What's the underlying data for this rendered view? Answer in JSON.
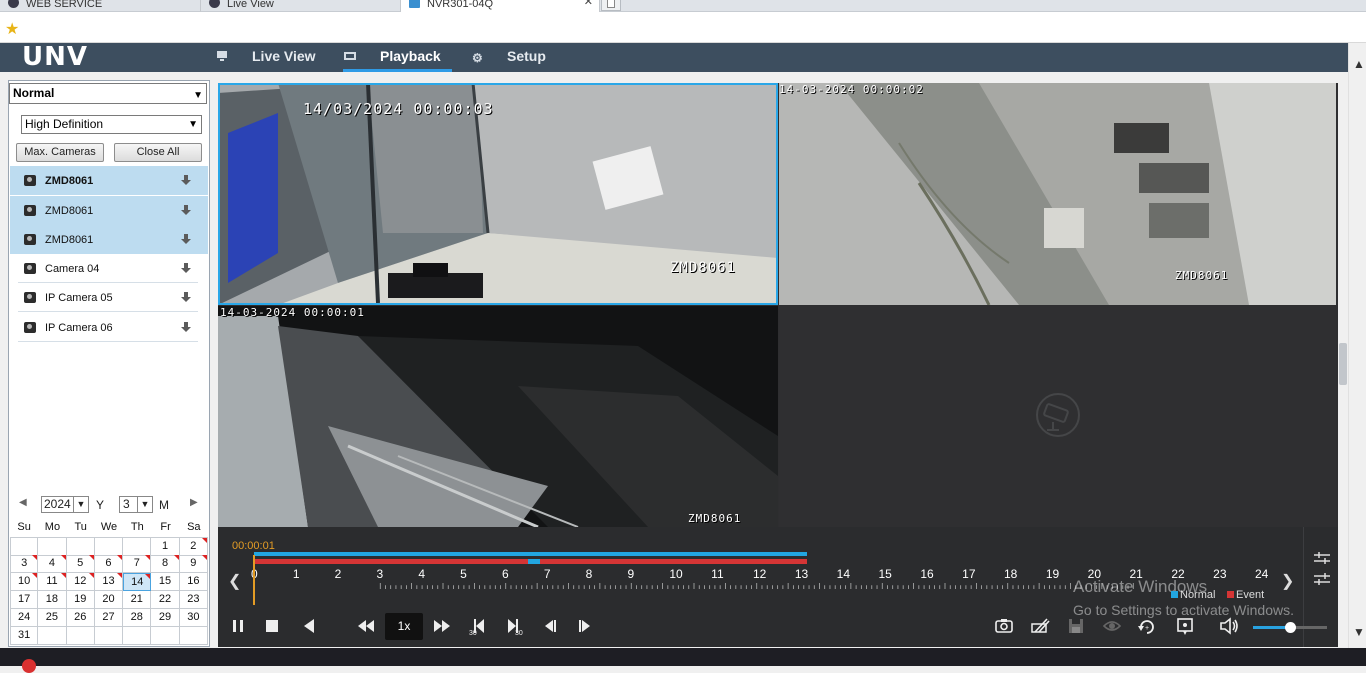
{
  "browser": {
    "tabs": [
      {
        "label": "WEB SERVICE"
      },
      {
        "label": "Live View"
      },
      {
        "label": "NVR301-04Q",
        "active": true
      }
    ]
  },
  "header": {
    "logo": "UNV",
    "nav": [
      {
        "label": "Live View",
        "icon": "monitor-icon"
      },
      {
        "label": "Playback",
        "icon": "film-icon",
        "active": true
      },
      {
        "label": "Setup",
        "icon": "gear-icon"
      }
    ]
  },
  "left": {
    "mode_select": "Normal",
    "quality_select": "High Definition",
    "max_cameras_label": "Max. Cameras",
    "close_all_label": "Close All",
    "cameras": [
      {
        "label": "ZMD8061",
        "selected": true,
        "bold": true
      },
      {
        "label": "ZMD8061",
        "selected": true
      },
      {
        "label": "ZMD8061",
        "selected": true
      },
      {
        "label": "Camera 04"
      },
      {
        "label": "IP Camera 05"
      },
      {
        "label": "IP Camera 06"
      }
    ],
    "calendar": {
      "year": "2024",
      "year_label": "Y",
      "month": "3",
      "month_label": "M",
      "weekdays": [
        "Su",
        "Mo",
        "Tu",
        "We",
        "Th",
        "Fr",
        "Sa"
      ],
      "today": "14"
    }
  },
  "videos": {
    "cell1": {
      "time": "14/03/2024  00:00:03",
      "name": "ZMD8061"
    },
    "cell2": {
      "time": "14-03-2024  00:00:02",
      "name": "ZMD8061"
    },
    "cell3": {
      "time": "14-03-2024  00:00:01",
      "name": "ZMD8061"
    }
  },
  "timeline": {
    "current_time": "00:00:01",
    "hours": [
      "0",
      "1",
      "2",
      "3",
      "4",
      "5",
      "6",
      "7",
      "8",
      "9",
      "10",
      "11",
      "12",
      "13",
      "14",
      "15",
      "16",
      "17",
      "18",
      "19",
      "20",
      "21",
      "22",
      "23",
      "24"
    ],
    "legend_normal": "Normal",
    "legend_event": "Event",
    "speed": "1x",
    "watermark_title": "Activate Windows",
    "watermark_sub": "Go to Settings to activate Windows.",
    "volume_fraction": 0.5
  },
  "colors": {
    "header": "#3d4e5f",
    "accent": "#2f9be6",
    "normal": "#22a6e1",
    "event": "#d53535",
    "time": "#e39c25"
  }
}
